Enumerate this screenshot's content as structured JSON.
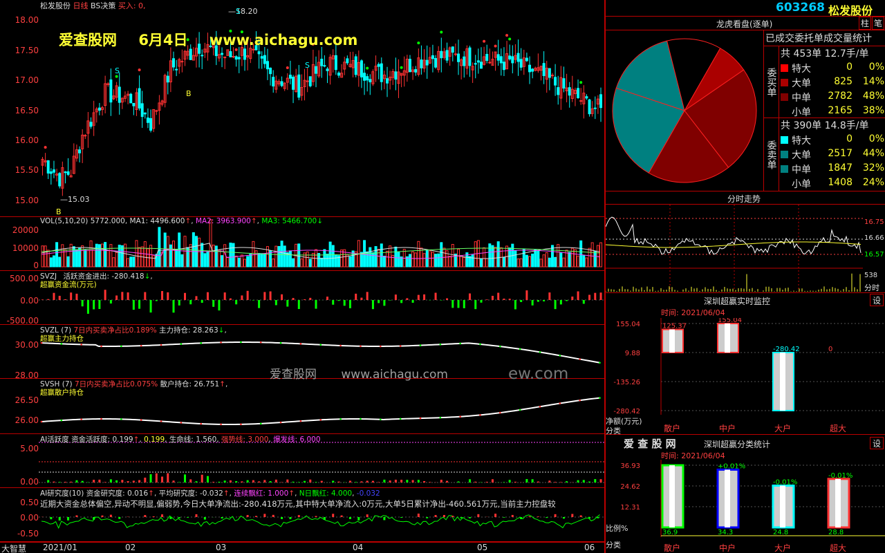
{
  "window": {
    "title": "松发股份",
    "period": "日线",
    "strategy": "BS决策",
    "buy_label": "买入: 0,"
  },
  "watermark": {
    "site": "爱查股网",
    "date": "6月4日",
    "url": "www.aichagu.com",
    "url2": "ew.com"
  },
  "kline": {
    "y_ticks": [
      "18.00",
      "17.50",
      "17.00",
      "16.50",
      "16.00",
      "15.50",
      "15.00"
    ],
    "high_label": "18.20",
    "low_label": "15.03",
    "signals": [
      "S",
      "B",
      "S",
      "B",
      "S"
    ]
  },
  "vol": {
    "label": "VOL(5,10,20)",
    "value": "5772.000",
    "ma1": "MA1: 4496.600",
    "ma2": "MA2: 3963.900",
    "ma3": "MA3: 5466.700",
    "y_ticks": [
      "20000",
      "10000",
      "0"
    ]
  },
  "svzj": {
    "label": "SVZJ",
    "title": "活跃资金进出: -280.418",
    "sub": "超赢资金流(万元)",
    "y_ticks": [
      "500.00",
      "0.00",
      "-500.00"
    ]
  },
  "svzl": {
    "label": "SVZL (7)",
    "ratio": "7日内买卖净占比0.189%",
    "hold": "主力持仓: 28.263",
    "sub": "超赢主力持仓",
    "y_ticks": [
      "30.00",
      "28.00"
    ]
  },
  "svsh": {
    "label": "SVSH (7)",
    "ratio": "7日内买卖净占比0.075%",
    "hold": "散户持仓: 26.751",
    "sub": "超赢散户持仓",
    "y_ticks": [
      "26.50",
      "26.00"
    ]
  },
  "ai_active": {
    "label": "AI活跃度",
    "active": "资金活跃度: 0.199",
    "v2": "0.199",
    "life": "生命线: 1.560",
    "strong": "强势线: 3.000",
    "burst": "爆发线: 6.000",
    "y_ticks": [
      "5.00",
      "0.00"
    ]
  },
  "ai_research": {
    "label": "AI研究度(10)",
    "r1": "资金研究度: 0.016",
    "r2": "平均研究度: -0.032",
    "r3": "连续飘红: 1.000",
    "r4": "N日飘红: 4.000",
    "r5": "-0.032",
    "text": "近期大资金总体偏空,异动不明显,偏弱势,今日大单净流出:-280.418万元,其中特大单净流入:0万元,大单5日累计净出-460.561万元,当前主力控盘较",
    "y_ticks": [
      "0.50",
      "0.00",
      "-0.50"
    ]
  },
  "xaxis": {
    "brand": "大智慧",
    "labels": [
      "2021/01",
      "02",
      "03",
      "04",
      "05",
      "06"
    ]
  },
  "stock": {
    "code": "603268",
    "name": "松发股份",
    "btn1": "柱",
    "btn2": "笔"
  },
  "dragon": {
    "title": "龙虎看盘(逐单)",
    "table_title": "已成交委托单成交量统计",
    "buy": {
      "side": "委买单",
      "total": "共 453单 12.7手/单",
      "rows": [
        {
          "name": "特大",
          "vol": "0",
          "pct": "0%"
        },
        {
          "name": "大单",
          "vol": "825",
          "pct": "14%"
        },
        {
          "name": "中单",
          "vol": "2782",
          "pct": "48%"
        },
        {
          "name": "小单",
          "vol": "2165",
          "pct": "38%"
        }
      ]
    },
    "sell": {
      "side": "委卖单",
      "total": "共 390单 14.8手/单",
      "rows": [
        {
          "name": "特大",
          "vol": "0",
          "pct": "0%"
        },
        {
          "name": "大单",
          "vol": "2517",
          "pct": "44%"
        },
        {
          "name": "中单",
          "vol": "1847",
          "pct": "32%"
        },
        {
          "name": "小单",
          "vol": "1408",
          "pct": "24%"
        }
      ]
    }
  },
  "intraday": {
    "title": "分时走势",
    "prices": [
      "16.75",
      "16.66",
      "16.57"
    ],
    "vol_tick": "538",
    "vol_unit": "分时"
  },
  "monitor": {
    "title": "深圳超赢实时监控",
    "btn": "设",
    "time": "时间: 2021/06/04",
    "y_ticks": [
      "155.04",
      "9.88",
      "-135.26",
      "-280.42"
    ],
    "unit": "净额(万元)",
    "cat_label": "分类",
    "bars": [
      {
        "cat": "散户",
        "value": "125.37"
      },
      {
        "cat": "中户",
        "value": "155.04"
      },
      {
        "cat": "大户",
        "value": "-280.42"
      },
      {
        "cat": "超大",
        "value": "0"
      }
    ]
  },
  "classify": {
    "brand": "爱 查 股 网",
    "title": "深圳超赢分类统计",
    "btn": "设",
    "time": "时间: 2021/06/04",
    "y_ticks": [
      "36.93",
      "24.62",
      "12.31"
    ],
    "ratio_label": "比例%",
    "cat_label": "分类",
    "bars": [
      {
        "cat": "散户",
        "ratio": "36.9",
        "change": ""
      },
      {
        "cat": "中户",
        "ratio": "34.3",
        "change": "+0.01%"
      },
      {
        "cat": "大户",
        "ratio": "24.8",
        "change": "-0.01%"
      },
      {
        "cat": "超大",
        "ratio": "28.8",
        "change": "-0.01%"
      }
    ]
  },
  "colors": {
    "up": "#ff3232",
    "down": "#00ffff",
    "grid": "#b00000",
    "axis": "#ff4040"
  }
}
